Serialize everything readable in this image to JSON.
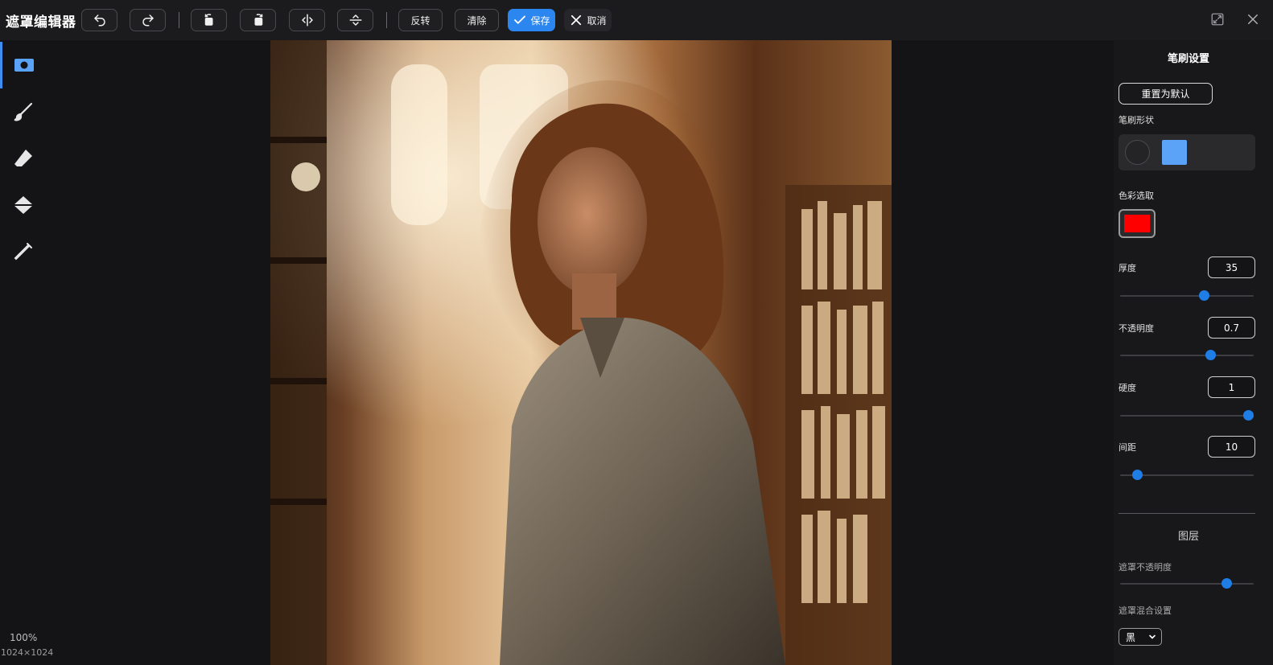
{
  "app": {
    "title": "遮罩编辑器"
  },
  "toolbar": {
    "invert_label": "反转",
    "clear_label": "清除",
    "save_label": "保存",
    "cancel_label": "取消"
  },
  "status": {
    "zoom": "100%",
    "dimensions": "1024×1024"
  },
  "left_tools": [
    "mask-view",
    "brush",
    "eraser",
    "fill-bucket",
    "color-picker"
  ],
  "panel": {
    "title": "笔刷设置",
    "reset_label": "重置为默认",
    "shape_label": "笔刷形状",
    "color_label": "色彩选取",
    "brush_color": "#ff0000",
    "thickness": {
      "label": "厚度",
      "value": "35",
      "fraction": 0.63
    },
    "opacity": {
      "label": "不透明度",
      "value": "0.7",
      "fraction": 0.68
    },
    "hardness": {
      "label": "硬度",
      "value": "1",
      "fraction": 0.96
    },
    "spacing": {
      "label": "间距",
      "value": "10",
      "fraction": 0.13
    },
    "layers_title": "图层",
    "mask_opacity": {
      "label": "遮罩不透明度",
      "fraction": 0.8
    },
    "blend_label": "遮罩混合设置",
    "blend_value": "黑"
  },
  "colors": {
    "accent": "#2b86f0",
    "knob": "#1f7de6",
    "shape_active": "#5aa3f7"
  }
}
